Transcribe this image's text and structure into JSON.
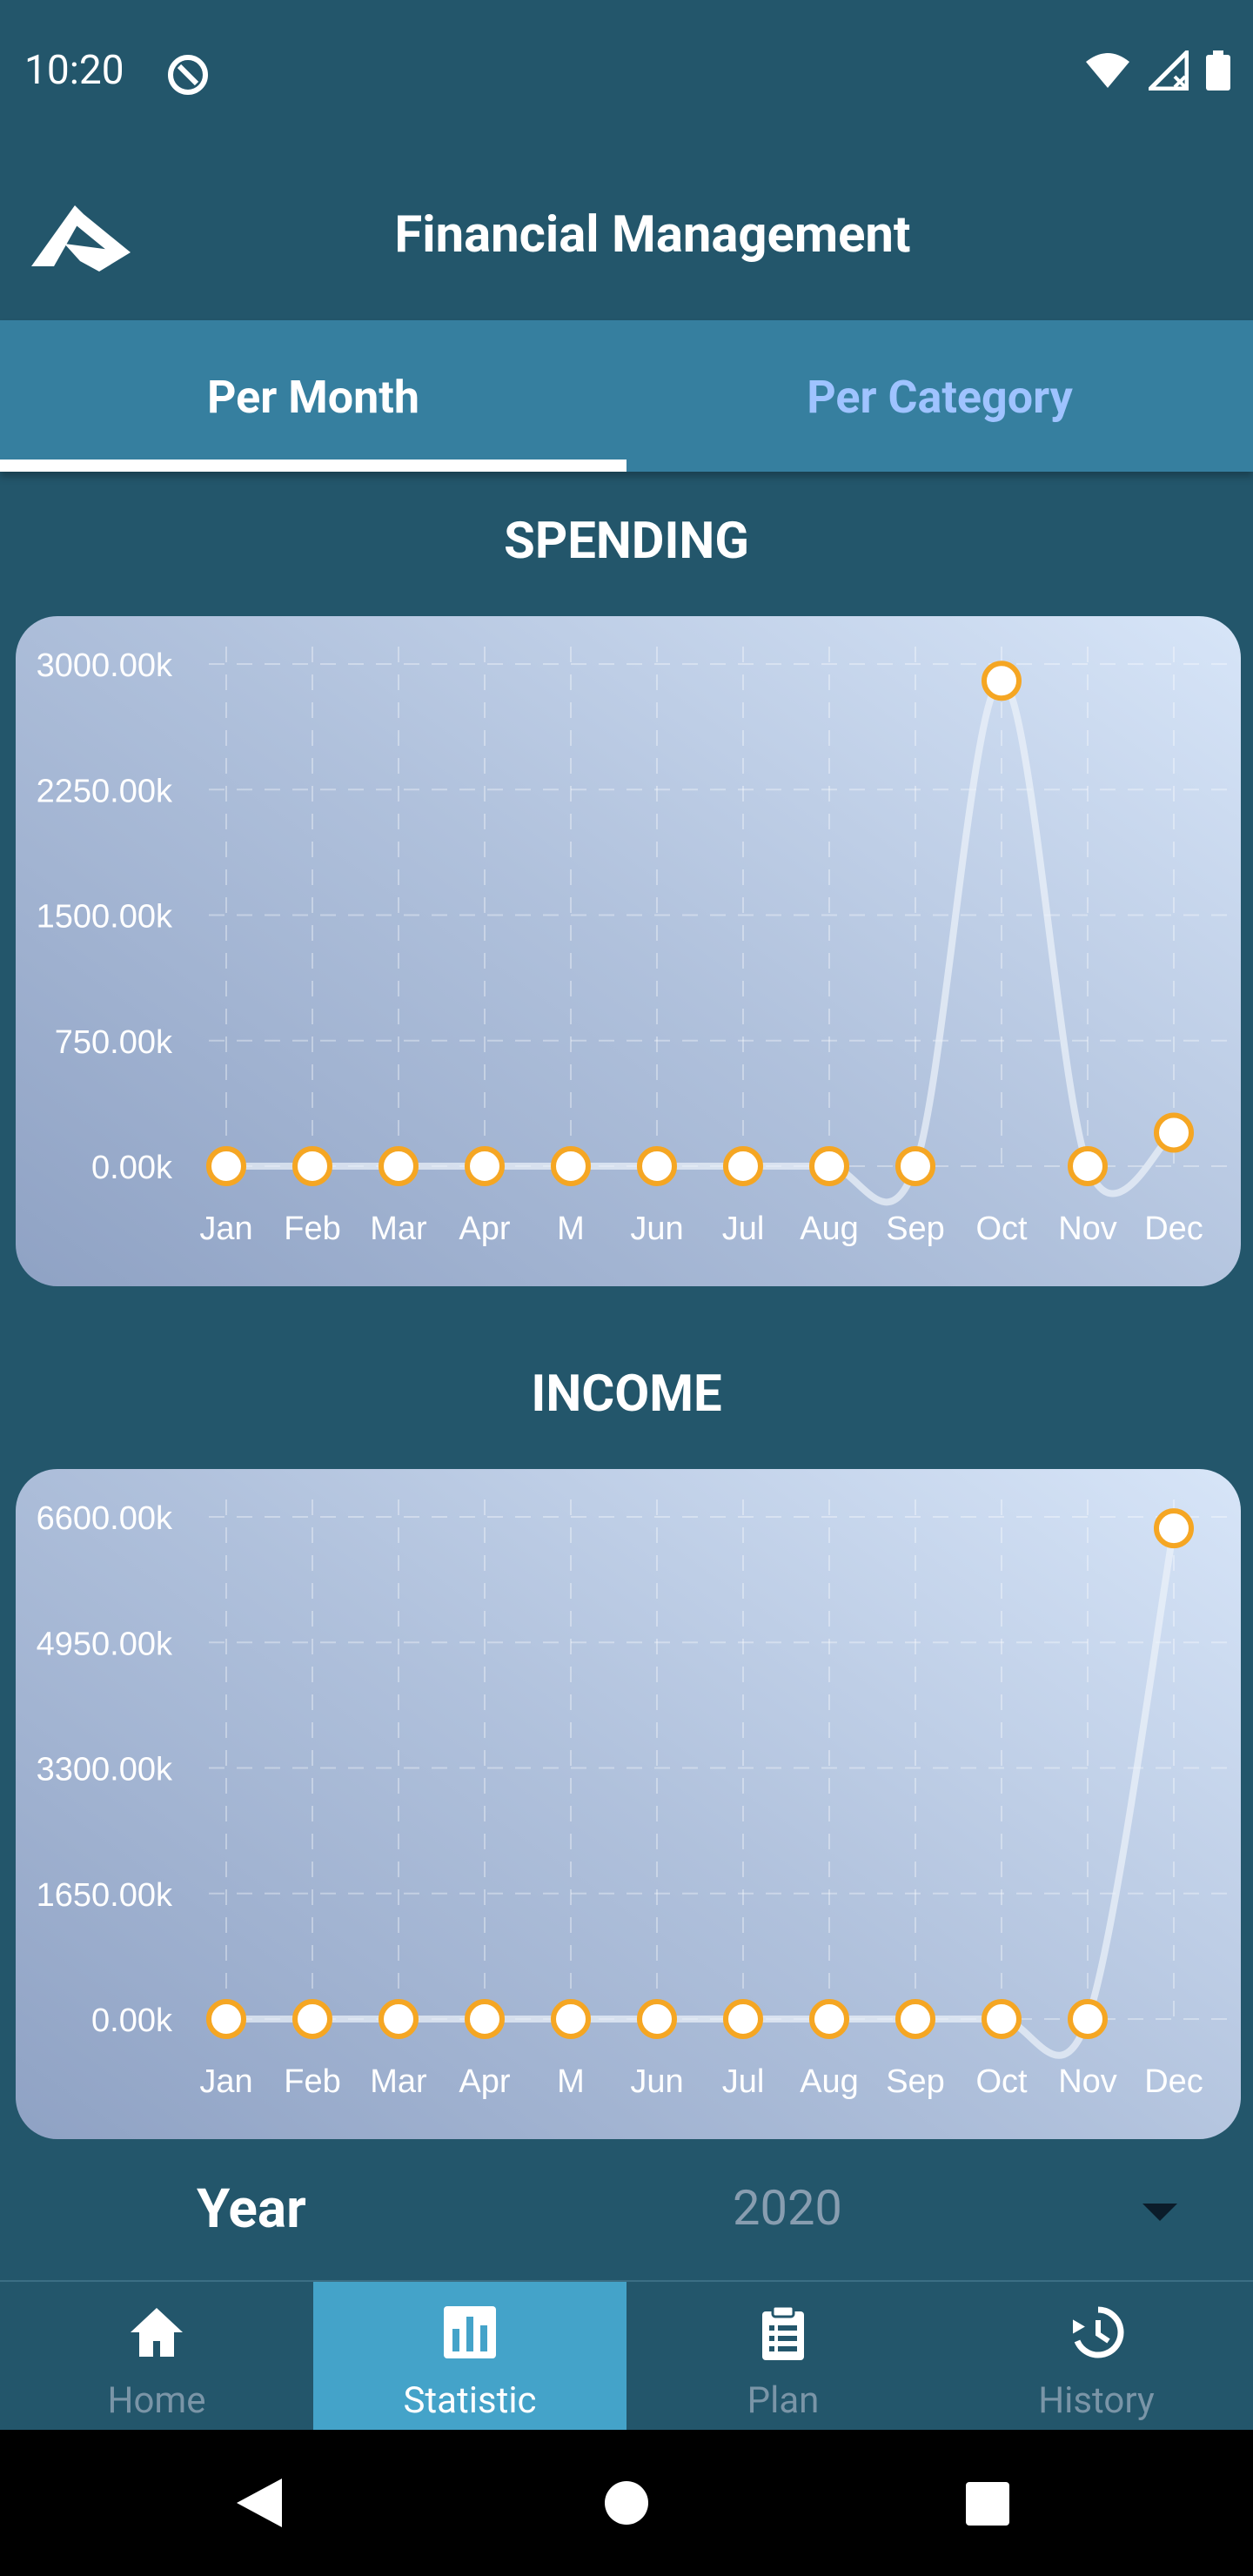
{
  "status_bar": {
    "time": "10:20"
  },
  "app_bar": {
    "title": "Financial Management"
  },
  "tabs": [
    {
      "label": "Per Month",
      "active": true
    },
    {
      "label": "Per Category",
      "active": false
    }
  ],
  "spending": {
    "title": "SPENDING",
    "chart_data": {
      "type": "line",
      "categories": [
        "Jan",
        "Feb",
        "Mar",
        "Apr",
        "M",
        "Jun",
        "Jul",
        "Aug",
        "Sep",
        "Oct",
        "Nov",
        "Dec"
      ],
      "values": [
        0,
        0,
        0,
        0,
        0,
        0,
        0,
        0,
        0,
        2900,
        0,
        200
      ],
      "unit": "k",
      "ylim": [
        0,
        3000
      ],
      "yticks": [
        "0.00k",
        "750.00k",
        "1500.00k",
        "2250.00k",
        "3000.00k"
      ],
      "grid": true
    }
  },
  "income": {
    "title": "INCOME",
    "chart_data": {
      "type": "line",
      "categories": [
        "Jan",
        "Feb",
        "Mar",
        "Apr",
        "M",
        "Jun",
        "Jul",
        "Aug",
        "Sep",
        "Oct",
        "Nov",
        "Dec"
      ],
      "values": [
        0,
        0,
        0,
        0,
        0,
        0,
        0,
        0,
        0,
        0,
        0,
        6450
      ],
      "unit": "k",
      "ylim": [
        0,
        6600
      ],
      "yticks": [
        "0.00k",
        "1650.00k",
        "3300.00k",
        "4950.00k",
        "6600.00k"
      ],
      "grid": true
    }
  },
  "year_filter": {
    "label": "Year",
    "value": "2020"
  },
  "bottom_nav": [
    {
      "label": "Home",
      "icon": "home-icon",
      "active": false
    },
    {
      "label": "Statistic",
      "icon": "bar-chart-icon",
      "active": true
    },
    {
      "label": "Plan",
      "icon": "clipboard-icon",
      "active": false
    },
    {
      "label": "History",
      "icon": "history-icon",
      "active": false
    }
  ],
  "colors": {
    "background": "#23566b",
    "tab_bar": "#367f9f",
    "accent_orange": "#f5a623",
    "nav_active": "#44a3c9"
  }
}
